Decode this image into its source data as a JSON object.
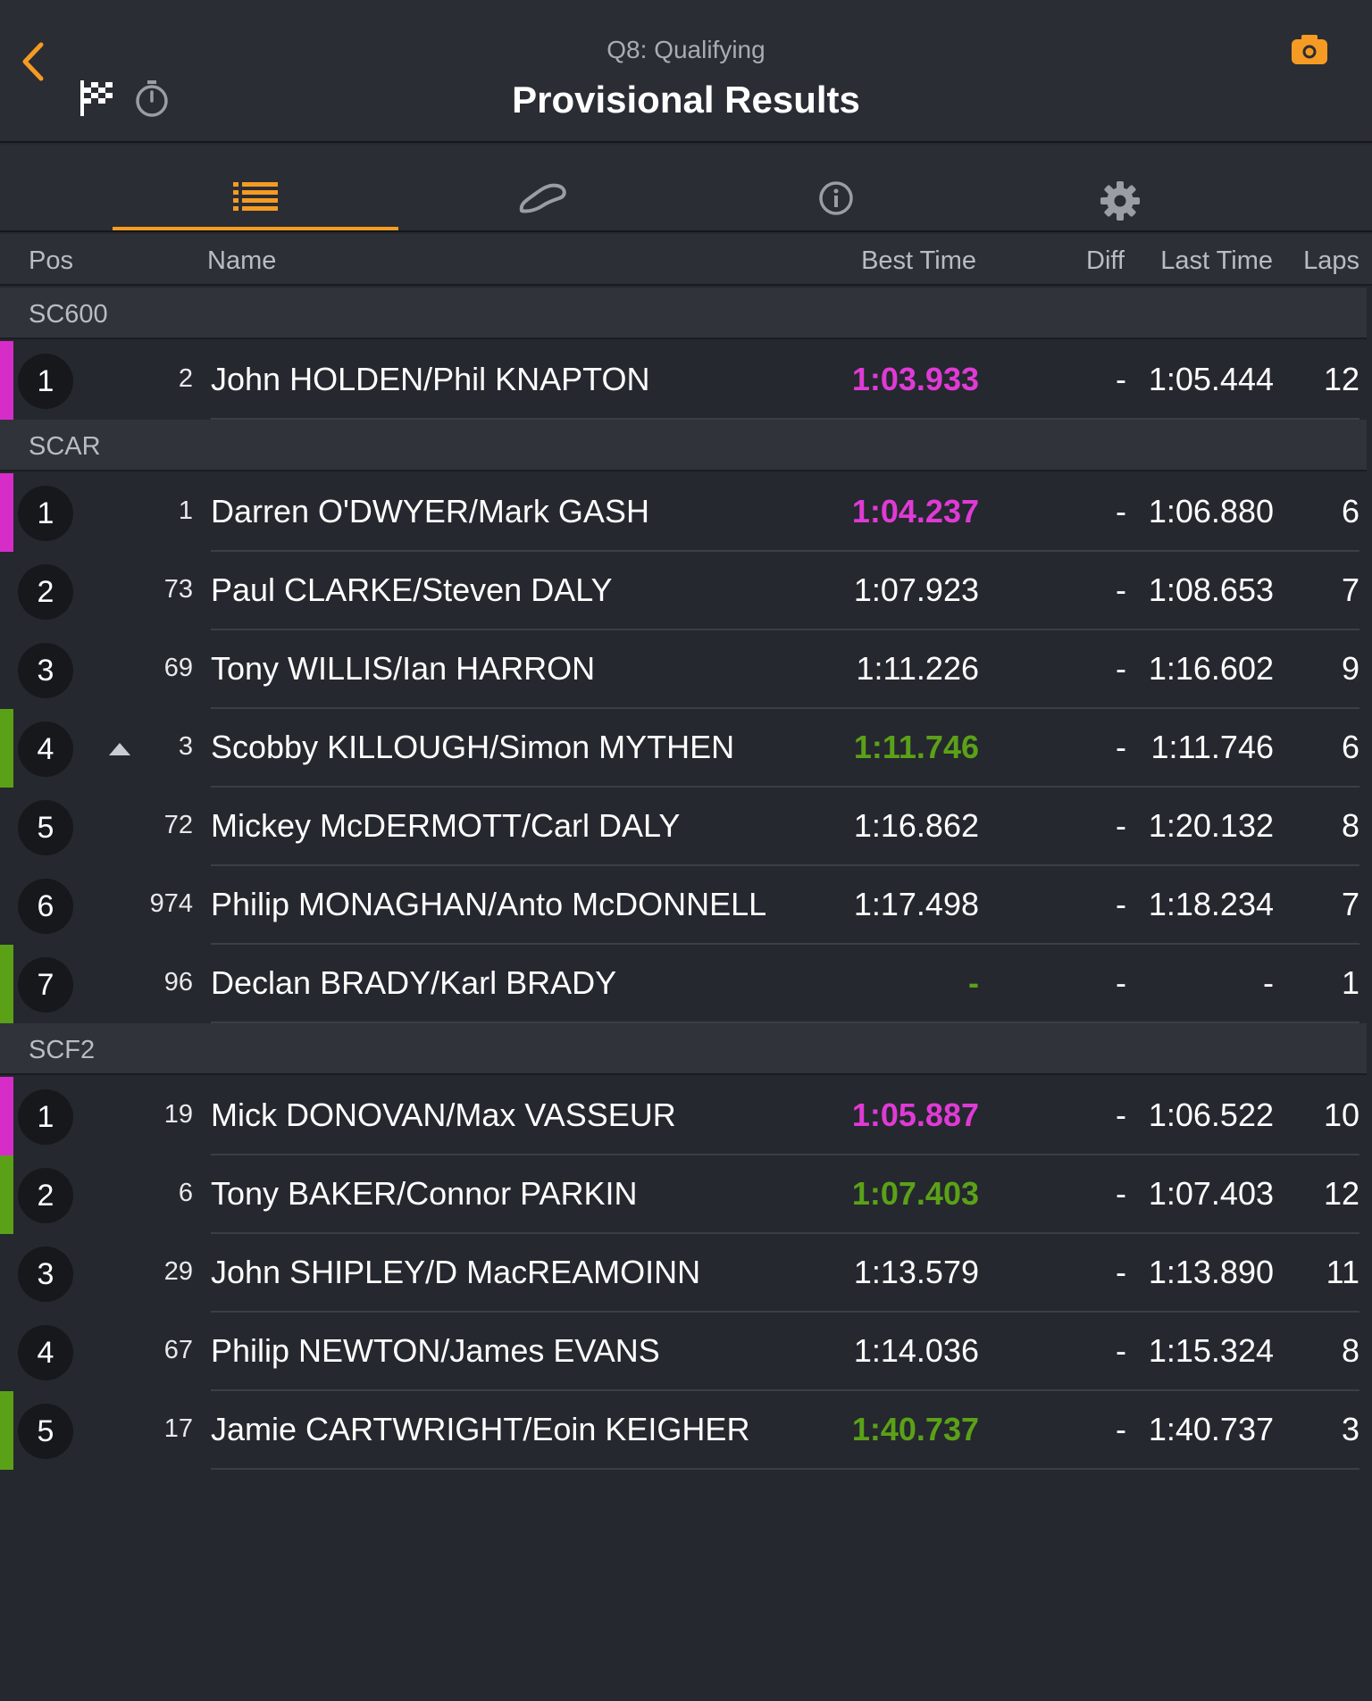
{
  "header": {
    "session": "Q8: Qualifying",
    "title": "Provisional Results"
  },
  "colors": {
    "accent": "#f59b23",
    "purple_time": "#e03ad6",
    "green_time": "#5ba118"
  },
  "columns": {
    "pos": "Pos",
    "name": "Name",
    "best": "Best Time",
    "diff": "Diff",
    "last": "Last Time",
    "laps": "Laps"
  },
  "tabs": [
    {
      "icon": "list-icon",
      "active": true
    },
    {
      "icon": "track-icon",
      "active": false
    },
    {
      "icon": "info-icon",
      "active": false
    },
    {
      "icon": "gear-icon",
      "active": false
    }
  ],
  "groups": [
    {
      "name": "SC600",
      "rows": [
        {
          "pos": "1",
          "no": "2",
          "name": "John HOLDEN/Phil KNAPTON",
          "best": "1:03.933",
          "diff": "-",
          "last": "1:05.444",
          "laps": "12",
          "stripe": "magenta",
          "best_style": "purple",
          "arrow": false
        }
      ]
    },
    {
      "name": "SCAR",
      "rows": [
        {
          "pos": "1",
          "no": "1",
          "name": "Darren O'DWYER/Mark GASH",
          "best": "1:04.237",
          "diff": "-",
          "last": "1:06.880",
          "laps": "6",
          "stripe": "magenta",
          "best_style": "purple",
          "arrow": false
        },
        {
          "pos": "2",
          "no": "73",
          "name": "Paul CLARKE/Steven DALY",
          "best": "1:07.923",
          "diff": "-",
          "last": "1:08.653",
          "laps": "7",
          "stripe": "",
          "best_style": "",
          "arrow": false
        },
        {
          "pos": "3",
          "no": "69",
          "name": "Tony WILLIS/Ian HARRON",
          "best": "1:11.226",
          "diff": "-",
          "last": "1:16.602",
          "laps": "9",
          "stripe": "",
          "best_style": "",
          "arrow": false
        },
        {
          "pos": "4",
          "no": "3",
          "name": "Scobby KILLOUGH/Simon MYTHEN",
          "best": "1:11.746",
          "diff": "-",
          "last": "1:11.746",
          "laps": "6",
          "stripe": "green",
          "best_style": "green",
          "arrow": true
        },
        {
          "pos": "5",
          "no": "72",
          "name": "Mickey McDERMOTT/Carl DALY",
          "best": "1:16.862",
          "diff": "-",
          "last": "1:20.132",
          "laps": "8",
          "stripe": "",
          "best_style": "",
          "arrow": false
        },
        {
          "pos": "6",
          "no": "974",
          "name": "Philip MONAGHAN/Anto McDONNELL",
          "best": "1:17.498",
          "diff": "-",
          "last": "1:18.234",
          "laps": "7",
          "stripe": "",
          "best_style": "",
          "arrow": false
        },
        {
          "pos": "7",
          "no": "96",
          "name": "Declan BRADY/Karl BRADY",
          "best": "-",
          "diff": "-",
          "last": "-",
          "laps": "1",
          "stripe": "green",
          "best_style": "green",
          "arrow": false
        }
      ]
    },
    {
      "name": "SCF2",
      "rows": [
        {
          "pos": "1",
          "no": "19",
          "name": "Mick DONOVAN/Max VASSEUR",
          "best": "1:05.887",
          "diff": "-",
          "last": "1:06.522",
          "laps": "10",
          "stripe": "magenta",
          "best_style": "purple",
          "arrow": false
        },
        {
          "pos": "2",
          "no": "6",
          "name": "Tony BAKER/Connor PARKIN",
          "best": "1:07.403",
          "diff": "-",
          "last": "1:07.403",
          "laps": "12",
          "stripe": "green",
          "best_style": "green",
          "arrow": false
        },
        {
          "pos": "3",
          "no": "29",
          "name": "John SHIPLEY/D MacREAMOINN",
          "best": "1:13.579",
          "diff": "-",
          "last": "1:13.890",
          "laps": "11",
          "stripe": "",
          "best_style": "",
          "arrow": false
        },
        {
          "pos": "4",
          "no": "67",
          "name": "Philip NEWTON/James EVANS",
          "best": "1:14.036",
          "diff": "-",
          "last": "1:15.324",
          "laps": "8",
          "stripe": "",
          "best_style": "",
          "arrow": false
        },
        {
          "pos": "5",
          "no": "17",
          "name": "Jamie CARTWRIGHT/Eoin KEIGHER",
          "best": "1:40.737",
          "diff": "-",
          "last": "1:40.737",
          "laps": "3",
          "stripe": "green",
          "best_style": "green",
          "arrow": false
        }
      ]
    }
  ]
}
